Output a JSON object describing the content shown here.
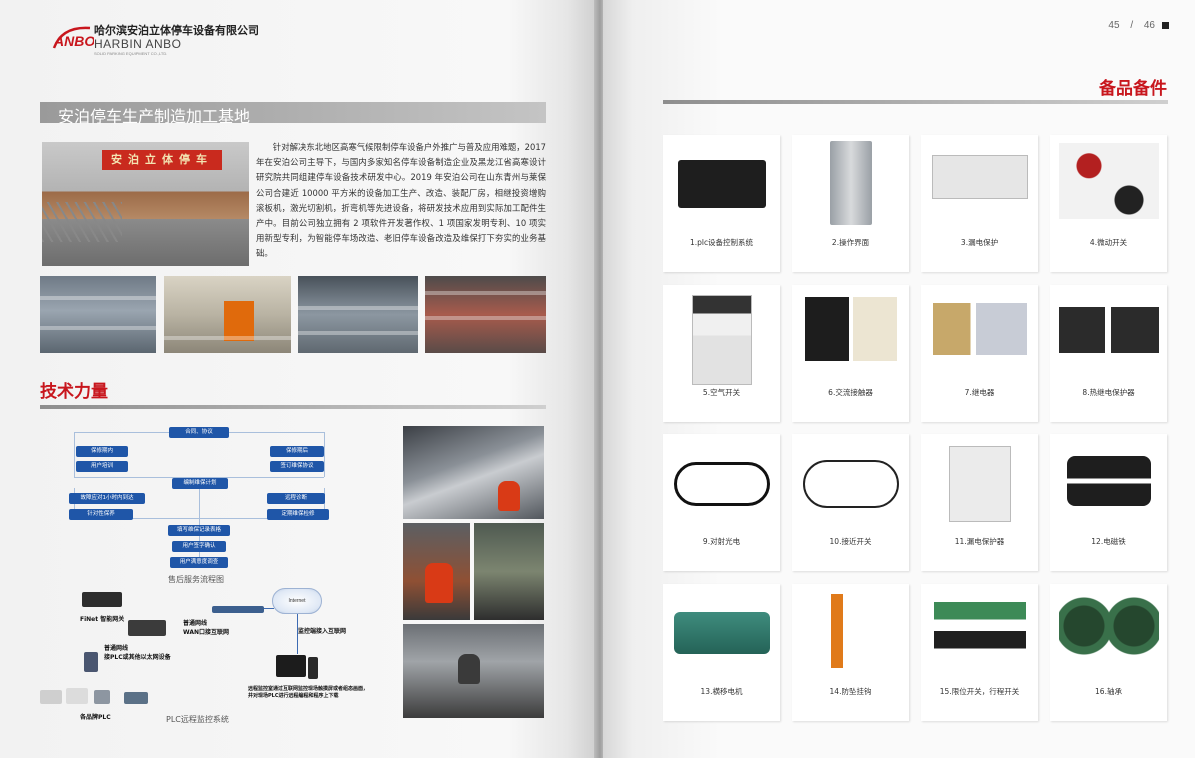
{
  "left_page": {
    "company_cn": "哈尔滨安泊立体停车设备有限公司",
    "company_en": "HARBIN ANBO",
    "company_sub": "SOLID PARKING EQUIPMENT CO.,LTD.",
    "logo_text": "ANBO",
    "section1_title": "安泊停车生产制造加工基地",
    "factory_sign": "安泊立体停车",
    "intro": "针对解决东北地区高寒气候限制停车设备户外推广与普及应用难题，2017 年在安泊公司主导下，与国内多家知名停车设备制造企业及黑龙江省高寒设计研究院共同组建停车设备技术研发中心。2019 年安泊公司在山东青州与莱保公司合建近 10000 平方米的设备加工生产、改造、装配厂房，相继投资增购滚板机，激光切割机，折弯机等先进设备，将研发技术应用到实际加工配件生产中。目前公司独立拥有 2 项软件开发著作权、1 项国家发明专利、10 项实用新型专利，为智能停车场改造、老旧停车设备改造及维保打下夯实的业务基础。",
    "section2_title": "技术力量",
    "flow": {
      "top": "合同、协议",
      "left1": "保修期内",
      "left2": "用户培训",
      "right1": "保修期后",
      "right2": "签订维保协议",
      "middle": "编制维保计划",
      "left3": "故障应对1小时内到达",
      "left4": "针对性保养",
      "right3": "远程诊断",
      "right4": "定期维保检修",
      "step1": "填写维保记录表格",
      "step2": "用户签字确认",
      "step3": "用户满意度调查",
      "caption": "售后服务流程图"
    },
    "plc": {
      "gateway": "FiNet 智能网关",
      "net1": "普通网线",
      "net1b": "WAN口接互联网",
      "internet": "Internet",
      "monitor_net": "监控端接入互联网",
      "net2": "普通网线",
      "net2b": "接PLC或其他以太网设备",
      "plc_label": "各品牌PLC",
      "remote": "远程监控室通过互联网监控现场触摸屏或者组态画面，并对现场PLC进行远程编程和程序上下载",
      "caption": "PLC远程监控系统"
    }
  },
  "right_page": {
    "page_current": "45",
    "page_sep": "/",
    "page_total": "46",
    "title": "备品备件",
    "items": [
      "1.plc设备控制系统",
      "2.操作界面",
      "3.漏电保护",
      "4.微动开关",
      "5.空气开关",
      "6.交流接触器",
      "7.继电器",
      "8.热继电保护器",
      "9.对射光电",
      "10.接近开关",
      "11.漏电保护器",
      "12.电磁铁",
      "13.横移电机",
      "14.防坠挂钩",
      "15.限位开关，行程开关",
      "16.轴承"
    ]
  },
  "colors": {
    "accent_red": "#c8161d",
    "flow_blue": "#1f56a8"
  }
}
